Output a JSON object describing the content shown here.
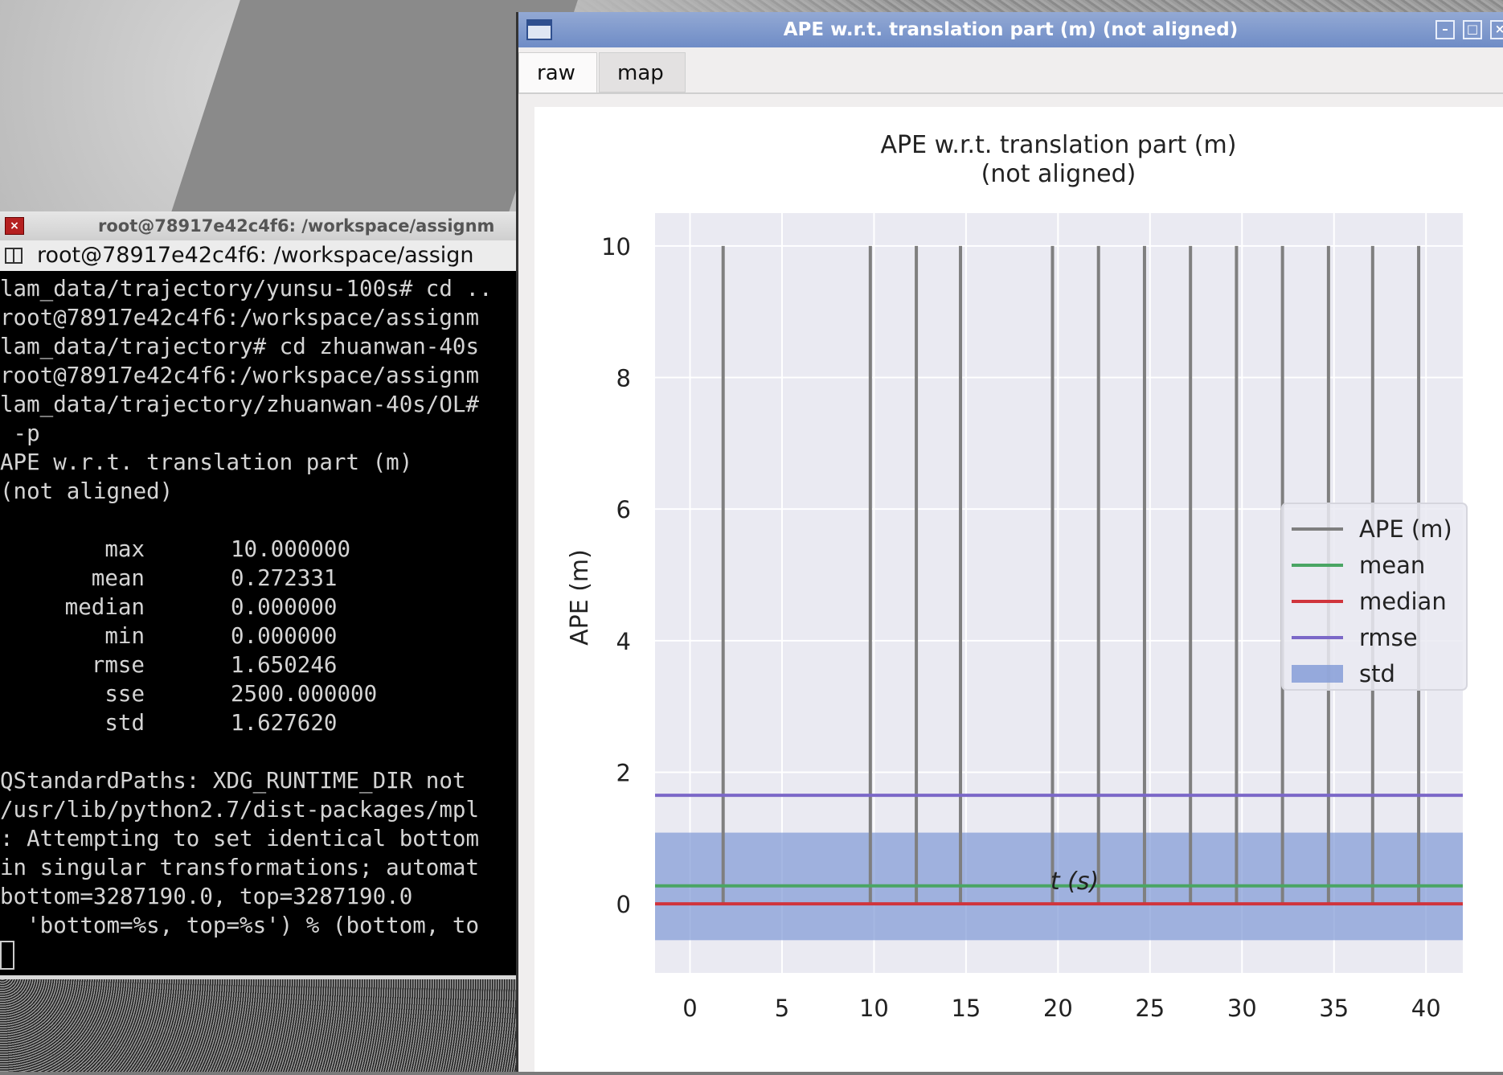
{
  "terminal": {
    "title": "root@78917e42c4f6: /workspace/assignm",
    "tab_label": "root@78917e42c4f6: /workspace/assign",
    "lines_top": [
      "lam_data/trajectory/yunsu-100s# cd ..",
      "root@78917e42c4f6:/workspace/assignm",
      "lam_data/trajectory# cd zhuanwan-40s",
      "root@78917e42c4f6:/workspace/assignm",
      "lam_data/trajectory/zhuanwan-40s/OL#",
      " -p",
      "APE w.r.t. translation part (m)",
      "(not aligned)",
      ""
    ],
    "stats": [
      {
        "name": "max",
        "value": "10.000000"
      },
      {
        "name": "mean",
        "value": "0.272331"
      },
      {
        "name": "median",
        "value": "0.000000"
      },
      {
        "name": "min",
        "value": "0.000000"
      },
      {
        "name": "rmse",
        "value": "1.650246"
      },
      {
        "name": "sse",
        "value": "2500.000000"
      },
      {
        "name": "std",
        "value": "1.627620"
      }
    ],
    "lines_bottom": [
      "",
      "QStandardPaths: XDG_RUNTIME_DIR not",
      "/usr/lib/python2.7/dist-packages/mpl",
      ": Attempting to set identical bottom",
      "in singular transformations; automat",
      "bottom=3287190.0, top=3287190.0",
      "  'bottom=%s, top=%s') % (bottom, to"
    ]
  },
  "window": {
    "title": "APE w.r.t. translation part (m) (not aligned)",
    "tabs": [
      {
        "label": "raw",
        "active": true
      },
      {
        "label": "map",
        "active": false
      }
    ]
  },
  "chart_data": {
    "type": "line",
    "title": "APE w.r.t. translation part (m)",
    "subtitle": "(not aligned)",
    "xlabel": "t (s)",
    "ylabel": "APE (m)",
    "xlim": [
      -1.9,
      42
    ],
    "ylim": [
      -1.05,
      10.5
    ],
    "xticks": [
      0,
      5,
      10,
      15,
      20,
      25,
      30,
      35,
      40
    ],
    "yticks": [
      0,
      2,
      4,
      6,
      8,
      10
    ],
    "grid": true,
    "legend_position": "center-right",
    "series": [
      {
        "name": "APE (m)",
        "color": "#7f7f7f",
        "baseline": 0,
        "spike_value": 10,
        "spike_times": [
          1.8,
          9.8,
          12.3,
          14.7,
          19.7,
          22.2,
          24.7,
          27.2,
          29.7,
          32.2,
          34.7,
          37.1,
          39.6
        ]
      },
      {
        "name": "mean",
        "color": "#4aa564",
        "value": 0.272331
      },
      {
        "name": "median",
        "color": "#d0343c",
        "value": 0.0
      },
      {
        "name": "rmse",
        "color": "#7b68c8",
        "value": 1.650246
      },
      {
        "name": "std",
        "color": "#7f98d6",
        "value_range": [
          -0.553,
          1.082
        ]
      }
    ]
  }
}
